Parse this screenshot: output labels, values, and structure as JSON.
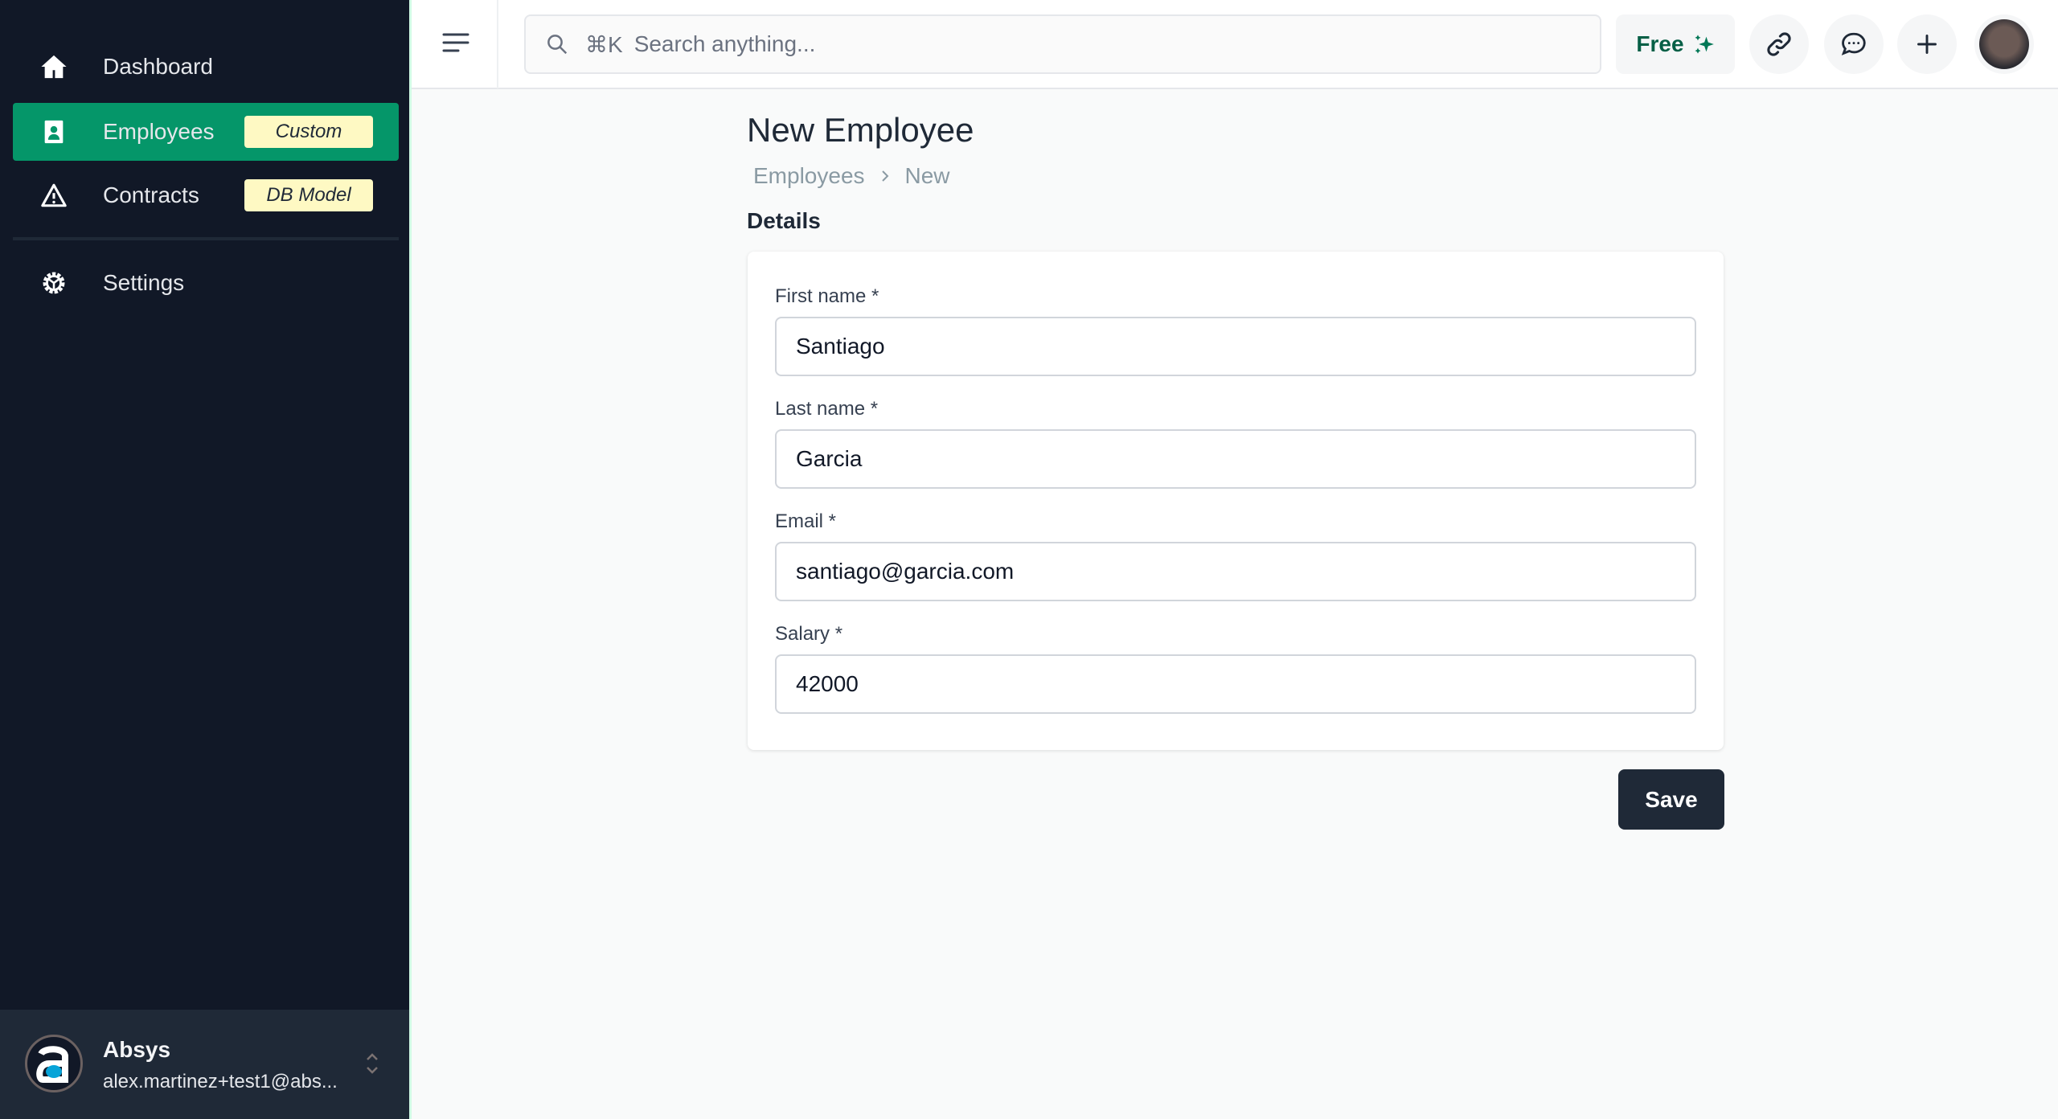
{
  "sidebar": {
    "items": [
      {
        "label": "Dashboard",
        "icon": "home-icon"
      },
      {
        "label": "Employees",
        "icon": "id-badge-icon",
        "badge": "Custom",
        "active": true
      },
      {
        "label": "Contracts",
        "icon": "warning-icon",
        "badge": "DB Model"
      },
      {
        "label": "Settings",
        "icon": "gear-icon"
      }
    ],
    "footer": {
      "org": "Absys",
      "email": "alex.martinez+test1@abs..."
    }
  },
  "header": {
    "search_shortcut": "⌘K",
    "search_placeholder": "Search anything...",
    "plan_label": "Free"
  },
  "page": {
    "title": "New Employee",
    "breadcrumb": [
      "Employees",
      "New"
    ],
    "section": "Details",
    "fields": [
      {
        "label": "First name *",
        "value": "Santiago"
      },
      {
        "label": "Last name *",
        "value": "Garcia"
      },
      {
        "label": "Email *",
        "value": "santiago@garcia.com"
      },
      {
        "label": "Salary *",
        "value": "42000"
      }
    ],
    "save_label": "Save"
  },
  "colors": {
    "sidebar_bg": "#111827",
    "active": "#059669",
    "badge": "#fef9c3",
    "primary_button": "#1f2937"
  }
}
